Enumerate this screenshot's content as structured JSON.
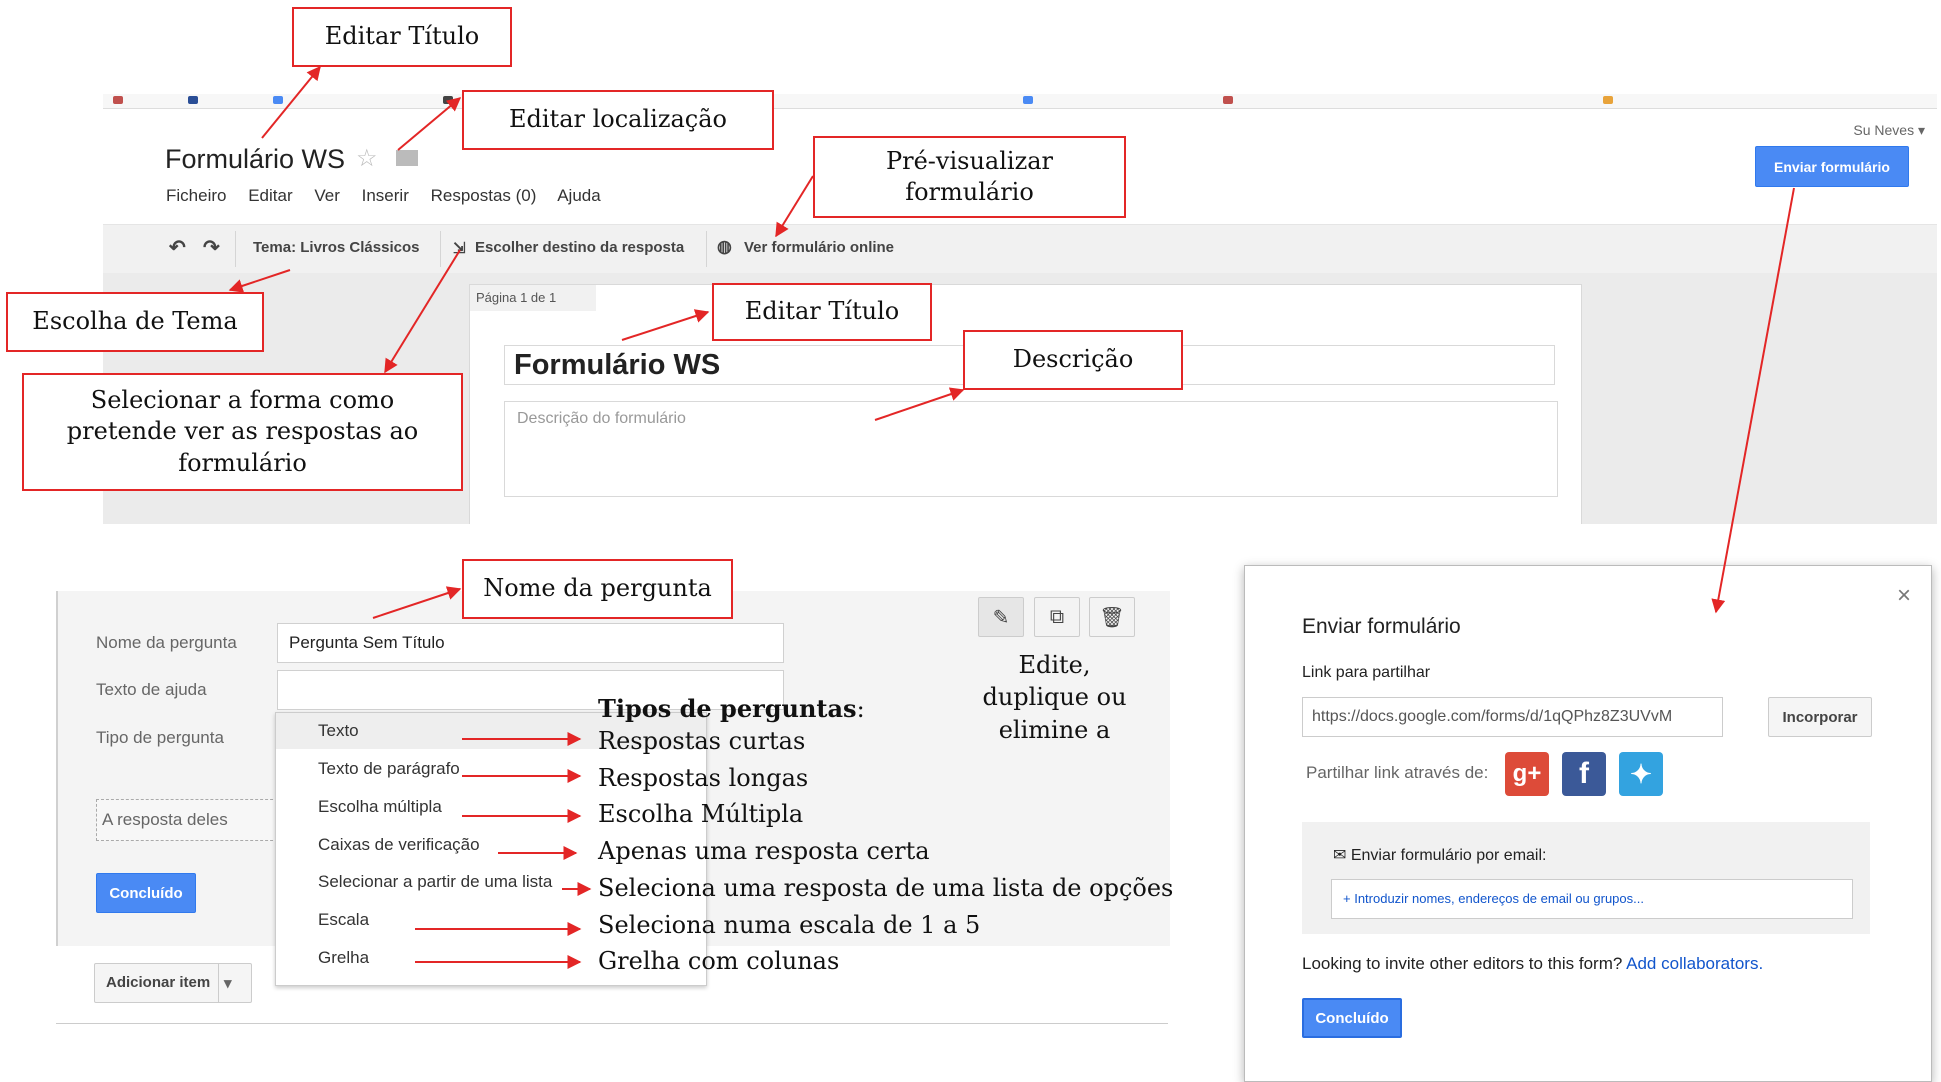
{
  "app": {
    "doc_title": "Formulário WS",
    "user": "Su Neves ▾",
    "send_button": "Enviar formulário",
    "menu": [
      "Ficheiro",
      "Editar",
      "Ver",
      "Inserir",
      "Respostas (0)",
      "Ajuda"
    ],
    "toolbar": {
      "theme": "Tema: Livros Clássicos",
      "destination": "Escolher destino da resposta",
      "view_live": "Ver formulário online"
    },
    "page_tab": "Página 1 de 1",
    "form_title": "Formulário WS",
    "description_placeholder": "Descrição do formulário"
  },
  "question": {
    "name_label": "Nome da pergunta",
    "name_value": "Pergunta Sem Título",
    "help_label": "Texto de ajuda",
    "type_label": "Tipo de pergunta",
    "answer_placeholder": "A resposta deles",
    "done_button": "Concluído",
    "add_item_button": "Adicionar item",
    "types": [
      "Texto",
      "Texto de parágrafo",
      "Escolha múltipla",
      "Caixas de verificação",
      "Selecionar a partir de uma lista",
      "Escala",
      "Grelha"
    ]
  },
  "share": {
    "title": "Enviar formulário",
    "link_label": "Link para partilhar",
    "link_value": "https://docs.google.com/forms/d/1qQPhz8Z3UVvM",
    "embed_button": "Incorporar",
    "share_via_label": "Partilhar link através de:",
    "email_label": "Enviar formulário por email:",
    "email_placeholder": "+ Introduzir nomes, endereços de email ou grupos...",
    "invite_text": "Looking to invite other editors to this form?",
    "invite_link": "Add collaborators.",
    "done_button": "Concluído",
    "social_icons": [
      "google-plus-icon",
      "facebook-icon",
      "twitter-icon"
    ]
  },
  "annotations": {
    "edit_title_top": "Editar Título",
    "edit_location": "Editar localização",
    "preview": "Pré-visualizar formulário",
    "theme_choice": "Escolha de Tema",
    "select_responses": "Selecionar a forma como pretende ver as respostas ao formulário",
    "edit_title_form": "Editar Título",
    "description": "Descrição",
    "question_name": "Nome da pergunta",
    "edit_tools": "Edite, duplique ou elimine a",
    "types_heading": "Tipos de perguntas",
    "types_heading_suffix": ":",
    "type_descriptions": [
      "Respostas curtas",
      "Respostas longas",
      "Escolha Múltipla",
      "Apenas uma resposta certa",
      "Seleciona uma resposta de uma lista de opções",
      "Seleciona numa escala de 1 a 5",
      "Grelha com colunas"
    ]
  },
  "colors": {
    "accent_blue": "#4a8af4",
    "annotation_red": "#e32626",
    "link_blue": "#1155cc"
  }
}
